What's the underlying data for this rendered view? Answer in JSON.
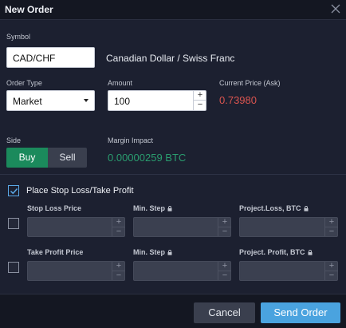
{
  "dialog": {
    "title": "New Order",
    "close_icon": "close-icon"
  },
  "symbol": {
    "label": "Symbol",
    "value": "CAD/CHF",
    "name": "Canadian Dollar / Swiss Franc"
  },
  "order_type": {
    "label": "Order Type",
    "selected": "Market",
    "arrow_icon": "caret-down-icon"
  },
  "amount": {
    "label": "Amount",
    "value": "100",
    "plus": "+",
    "minus": "−"
  },
  "current_price": {
    "label": "Current Price (Ask)",
    "value": "0.73980",
    "color": "#d9544f"
  },
  "side": {
    "label": "Side",
    "options": [
      "Buy",
      "Sell"
    ],
    "selected": "Buy",
    "buy_color": "#1b8a5c"
  },
  "margin_impact": {
    "label": "Margin Impact",
    "value": "0.00000259 BTC",
    "color": "#2a9d6f"
  },
  "stop_take": {
    "label": "Place Stop Loss/Take Profit",
    "checked": true,
    "rows": [
      {
        "checked": false,
        "cols": [
          {
            "label": "Stop Loss Price",
            "locked": false
          },
          {
            "label": "Min. Step",
            "locked": true
          },
          {
            "label": "Project.Loss, BTC",
            "locked": true
          }
        ]
      },
      {
        "checked": false,
        "cols": [
          {
            "label": "Take Profit Price",
            "locked": false
          },
          {
            "label": "Min. Step",
            "locked": true
          },
          {
            "label": "Project. Profit, BTC",
            "locked": true
          }
        ]
      }
    ],
    "plus": "+",
    "minus": "−"
  },
  "footer": {
    "cancel_label": "Cancel",
    "send_label": "Send Order",
    "send_color": "#4aa3df"
  }
}
